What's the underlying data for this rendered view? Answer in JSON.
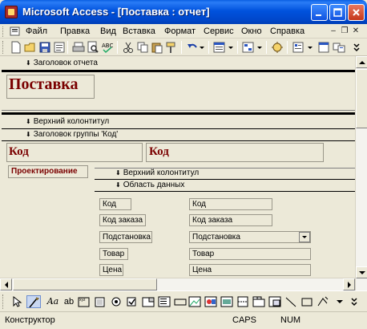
{
  "window": {
    "title": "Microsoft Access - [Поставка : отчет]"
  },
  "menu": {
    "items": [
      "Файл",
      "Правка",
      "Вид",
      "Вставка",
      "Формат",
      "Сервис",
      "Окно",
      "Справка"
    ],
    "mdi_min": "–",
    "mdi_restore": "❐",
    "mdi_close": "✕"
  },
  "sections": {
    "report_header": "Заголовок отчета",
    "page_header": "Верхний колонтитул",
    "group_header": "Заголовок группы 'Код'",
    "page_header_2": "Верхний колонтитул",
    "detail": "Область данных"
  },
  "report": {
    "title_label": "Поставка",
    "group_label": "Код",
    "group_field": "Код",
    "group_sub_label": "Проектирование"
  },
  "detail_fields": [
    {
      "label": "Код",
      "field": "Код"
    },
    {
      "label": "Код заказа",
      "field": "Код заказа"
    },
    {
      "label": "Подстановка",
      "field": "Подстановка"
    },
    {
      "label": "Товар",
      "field": "Товар"
    },
    {
      "label": "Цена",
      "field": "Цена"
    }
  ],
  "status": {
    "mode": "Конструктор",
    "caps": "CAPS",
    "num": "NUM"
  },
  "colors": {
    "titlebar": "#0052dd",
    "accent_text": "#7a0000",
    "workspace": "#ece9d8"
  }
}
